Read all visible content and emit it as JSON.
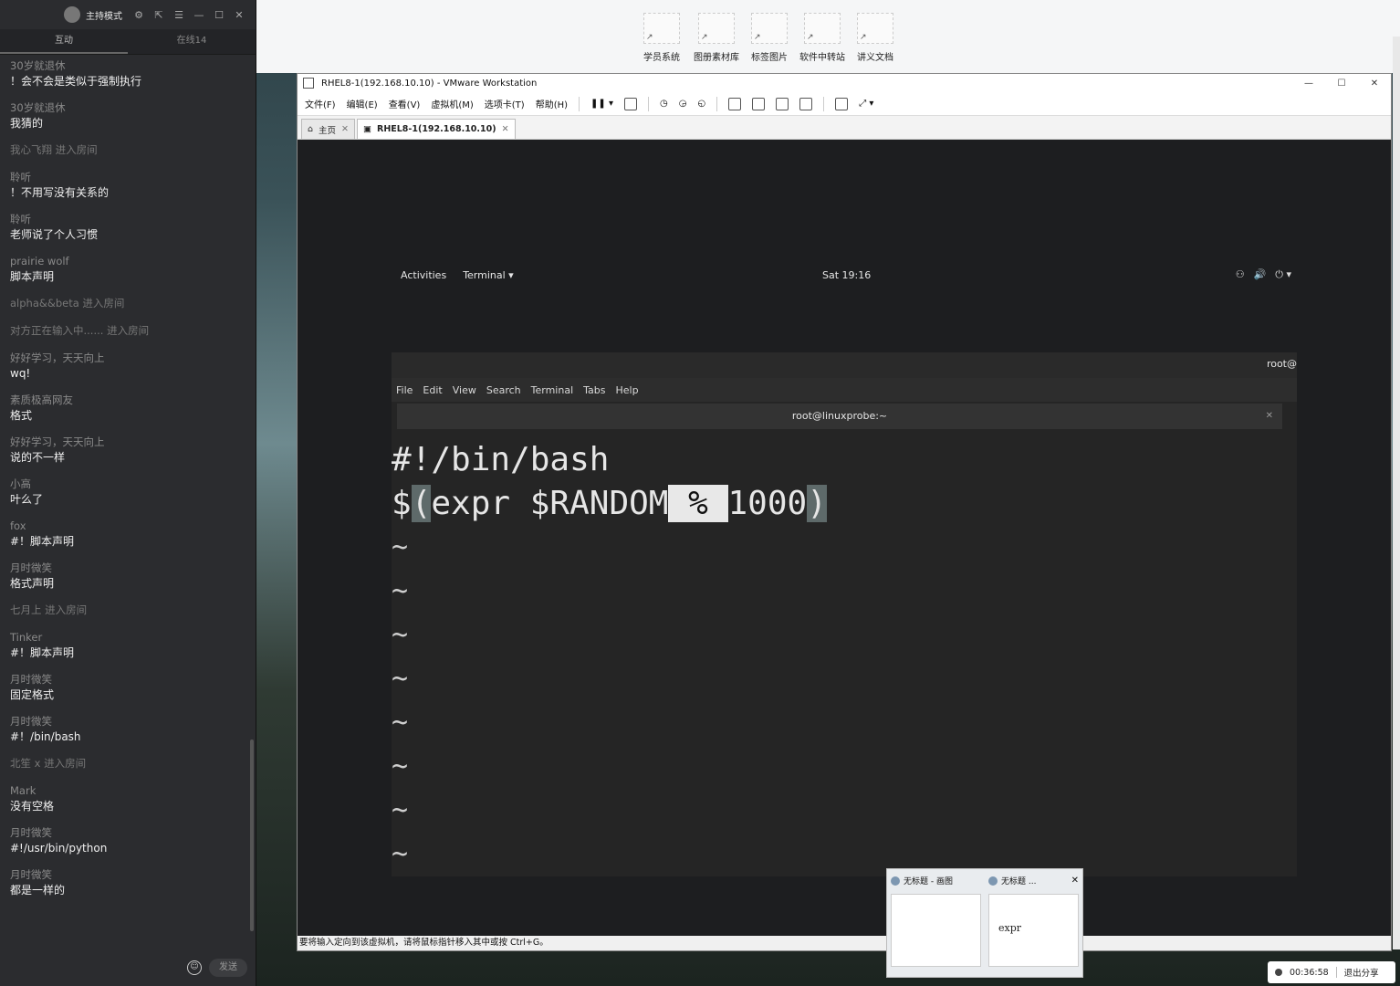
{
  "chat": {
    "mode_label": "主持模式",
    "tabs": [
      "互动",
      "在线14"
    ],
    "messages": [
      {
        "name": "30岁就退休",
        "text": "！会不会是类似于强制执行"
      },
      {
        "name": "30岁就退休",
        "text": "我猜的"
      },
      {
        "name": "我心飞翔 进入房间",
        "text": ""
      },
      {
        "name": "聆听",
        "text": "！不用写没有关系的"
      },
      {
        "name": "聆听",
        "text": "老师说了个人习惯"
      },
      {
        "name": "prairie wolf",
        "text": "脚本声明"
      },
      {
        "name": "alpha&&beta 进入房间",
        "text": ""
      },
      {
        "name": "对方正在输入中...... 进入房间",
        "text": ""
      },
      {
        "name": "好好学习，天天向上",
        "text": "wq!"
      },
      {
        "name": "素质极高网友",
        "text": "格式"
      },
      {
        "name": "好好学习，天天向上",
        "text": "说的不一样"
      },
      {
        "name": "小高",
        "text": "叶么了"
      },
      {
        "name": "fox",
        "text": "#！脚本声明"
      },
      {
        "name": "月时微笑",
        "text": "格式声明"
      },
      {
        "name": "七月上 进入房间",
        "text": ""
      },
      {
        "name": "Tinker",
        "text": "#！脚本声明"
      },
      {
        "name": "月时微笑",
        "text": "固定格式"
      },
      {
        "name": "月时微笑",
        "text": "#！/bin/bash"
      },
      {
        "name": "北笙 x 进入房间",
        "text": ""
      },
      {
        "name": "Mark",
        "text": "没有空格"
      },
      {
        "name": "月时微笑",
        "text": "#!/usr/bin/python"
      },
      {
        "name": "月时微笑",
        "text": "都是一样的"
      }
    ],
    "send_label": "发送"
  },
  "desktop": {
    "icons": [
      "学员系统",
      "图册素材库",
      "标签图片",
      "软件中转站",
      "讲义文档"
    ]
  },
  "vmware": {
    "title": "RHEL8-1(192.168.10.10) - VMware Workstation",
    "menu": [
      "文件(F)",
      "编辑(E)",
      "查看(V)",
      "虚拟机(M)",
      "选项卡(T)",
      "帮助(H)"
    ],
    "tabs": {
      "home": "主页",
      "vm": "RHEL8-1(192.168.10.10)"
    },
    "status_text": "要将输入定向到该虚拟机，请将鼠标指针移入其中或按 Ctrl+G。"
  },
  "gnome": {
    "activities": "Activities",
    "app_menu": "Terminal ▾",
    "clock": "Sat 19:16"
  },
  "terminal": {
    "header_user": "root@",
    "menu": [
      "File",
      "Edit",
      "View",
      "Search",
      "Terminal",
      "Tabs",
      "Help"
    ],
    "tab_title": "root@linuxprobe:~",
    "line1": "#!/bin/bash",
    "line2_parts": [
      "$",
      "(",
      "expr $RANDOM",
      " % ",
      "1000",
      ")"
    ],
    "tilde": "~"
  },
  "taskbar_preview": {
    "items": [
      {
        "title": "无标题 - 画图",
        "preview": ""
      },
      {
        "title": "无标题 ...",
        "preview": "expr"
      }
    ]
  },
  "share": {
    "timer": "00:36:58",
    "exit_label": "退出分享"
  }
}
